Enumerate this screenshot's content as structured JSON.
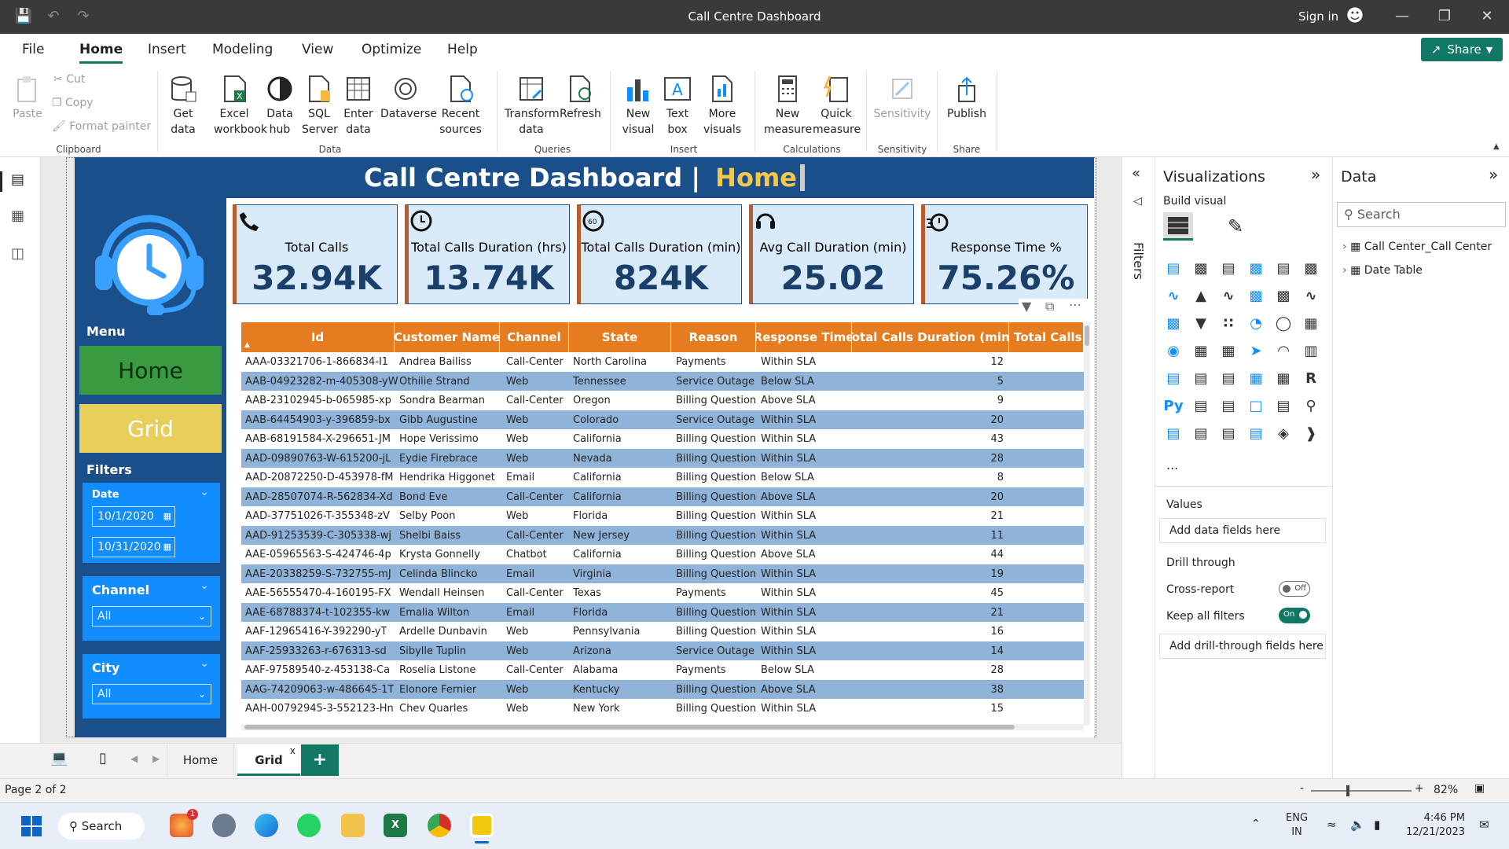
{
  "window": {
    "title": "Call Centre Dashboard",
    "sign_in": "Sign in"
  },
  "menu": {
    "tabs": [
      "File",
      "Home",
      "Insert",
      "Modeling",
      "View",
      "Optimize",
      "Help"
    ],
    "share": "Share"
  },
  "ribbon": {
    "clipboard": {
      "paste": "Paste",
      "cut": "Cut",
      "copy": "Copy",
      "format_painter": "Format painter",
      "group": "Clipboard"
    },
    "data": {
      "get_data": "Get data",
      "excel": "Excel workbook",
      "data_hub": "Data hub",
      "sql": "SQL Server",
      "enter_data": "Enter data",
      "dataverse": "Dataverse",
      "recent": "Recent sources",
      "group": "Data"
    },
    "queries": {
      "transform": "Transform data",
      "refresh": "Refresh",
      "group": "Queries"
    },
    "insert": {
      "new_visual": "New visual",
      "text_box": "Text box",
      "more_visuals": "More visuals",
      "group": "Insert"
    },
    "calculations": {
      "new_measure": "New measure",
      "quick_measure": "Quick measure",
      "group": "Calculations"
    },
    "sensitivity": {
      "label": "Sensitivity",
      "group": "Sensitivity"
    },
    "share": {
      "publish": "Publish",
      "group": "Share"
    }
  },
  "dashboard": {
    "title": "Call Centre Dashboard | ",
    "title_highlight": "Home",
    "kpis": [
      {
        "label": "Total Calls",
        "value": "32.94K"
      },
      {
        "label": "Total Calls Duration (hrs)",
        "value": "13.74K"
      },
      {
        "label": "Total Calls Duration (min)",
        "value": "824K"
      },
      {
        "label": "Avg Call Duration (min)",
        "value": "25.02"
      },
      {
        "label": "Response Time %",
        "value": "75.26%"
      }
    ],
    "menu_label": "Menu",
    "nav": {
      "home": "Home",
      "grid": "Grid"
    },
    "filters_label": "Filters",
    "date": {
      "label": "Date",
      "from": "10/1/2020",
      "to": "10/31/2020"
    },
    "channel": {
      "label": "Channel",
      "value": "All"
    },
    "city": {
      "label": "City",
      "value": "All"
    },
    "colors": {
      "navy": "#1b4f8a",
      "orange": "#e57c1f",
      "green": "#3a9a3f",
      "yellow": "#e8cf5a",
      "row_alt": "#8fb3d9"
    }
  },
  "table": {
    "columns": [
      "Id",
      "Customer Name",
      "Channel",
      "State",
      "Reason",
      "Response Time",
      "Total Calls Duration (min)",
      "Total Calls Du"
    ],
    "rows": [
      [
        "AAA-03321706-1-866834-I1",
        "Andrea Bailiss",
        "Call-Center",
        "North Carolina",
        "Payments",
        "Within SLA",
        "12"
      ],
      [
        "AAB-04923282-m-405308-yW",
        "Othilie Strand",
        "Web",
        "Tennessee",
        "Service Outage",
        "Below SLA",
        "5"
      ],
      [
        "AAB-23102945-b-065985-xp",
        "Sondra Bearman",
        "Call-Center",
        "Oregon",
        "Billing Question",
        "Above SLA",
        "9"
      ],
      [
        "AAB-64454903-y-396859-bx",
        "Gibb Augustine",
        "Web",
        "Colorado",
        "Service Outage",
        "Within SLA",
        "20"
      ],
      [
        "AAB-68191584-X-296651-JM",
        "Hope Verissimo",
        "Web",
        "California",
        "Billing Question",
        "Within SLA",
        "43"
      ],
      [
        "AAD-09890763-W-615200-jL",
        "Eydie Firebrace",
        "Web",
        "Nevada",
        "Billing Question",
        "Within SLA",
        "28"
      ],
      [
        "AAD-20872250-D-453978-fM",
        "Hendrika Higgonet",
        "Email",
        "California",
        "Billing Question",
        "Below SLA",
        "8"
      ],
      [
        "AAD-28507074-R-562834-Xd",
        "Bond Eve",
        "Call-Center",
        "California",
        "Billing Question",
        "Above SLA",
        "20"
      ],
      [
        "AAD-37751026-T-355348-zV",
        "Selby Poon",
        "Web",
        "Florida",
        "Billing Question",
        "Within SLA",
        "21"
      ],
      [
        "AAD-91253539-C-305338-wj",
        "Shelbi Baiss",
        "Call-Center",
        "New Jersey",
        "Billing Question",
        "Within SLA",
        "11"
      ],
      [
        "AAE-05965563-S-424746-4p",
        "Krysta Gonnelly",
        "Chatbot",
        "California",
        "Billing Question",
        "Above SLA",
        "44"
      ],
      [
        "AAE-20338259-S-732755-mJ",
        "Celinda Blincko",
        "Email",
        "Virginia",
        "Billing Question",
        "Within SLA",
        "19"
      ],
      [
        "AAE-56555470-4-160195-FX",
        "Wendall Heinsen",
        "Call-Center",
        "Texas",
        "Payments",
        "Within SLA",
        "45"
      ],
      [
        "AAE-68788374-t-102355-kw",
        "Emalia Wilton",
        "Email",
        "Florida",
        "Billing Question",
        "Within SLA",
        "21"
      ],
      [
        "AAF-12965416-Y-392290-yT",
        "Ardelle Dunbavin",
        "Web",
        "Pennsylvania",
        "Billing Question",
        "Within SLA",
        "16"
      ],
      [
        "AAF-25933263-r-676313-sd",
        "Sibylle Tuplin",
        "Web",
        "Arizona",
        "Service Outage",
        "Within SLA",
        "14"
      ],
      [
        "AAF-97589540-z-453138-Ca",
        "Roselia Listone",
        "Call-Center",
        "Alabama",
        "Payments",
        "Below SLA",
        "28"
      ],
      [
        "AAG-74209063-w-486645-1T",
        "Elonore Fernier",
        "Web",
        "Kentucky",
        "Billing Question",
        "Above SLA",
        "38"
      ],
      [
        "AAH-00792945-3-552123-Hn",
        "Chev Quarles",
        "Web",
        "New York",
        "Billing Question",
        "Within SLA",
        "15"
      ]
    ]
  },
  "panes": {
    "filters": "Filters",
    "visualizations": "Visualizations",
    "build_visual": "Build visual",
    "data": "Data",
    "search_placeholder": "Search",
    "tables": [
      "Call Center_Call Center",
      "Date Table"
    ],
    "values": "Values",
    "add_data_fields": "Add data fields here",
    "drill_through": "Drill through",
    "cross_report": "Cross-report",
    "cross_report_state": "Off",
    "keep_filters": "Keep all filters",
    "keep_filters_state": "On",
    "add_drill": "Add drill-through fields here",
    "more": "..."
  },
  "pages": {
    "tabs": [
      "Home",
      "Grid"
    ],
    "add": "+",
    "close": "x"
  },
  "status": {
    "page": "Page 2 of 2",
    "zoom": "82%"
  },
  "taskbar": {
    "search": "Search",
    "lang": "ENG",
    "region": "IN",
    "time": "4:46 PM",
    "date": "12/21/2023",
    "badge": "1"
  }
}
